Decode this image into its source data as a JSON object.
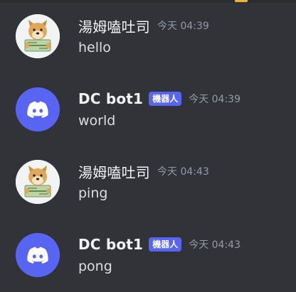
{
  "colors": {
    "background": "#313338",
    "blurple": "#5865f2",
    "username": "#f2f3f5",
    "timestamp": "#949ba4",
    "message_text": "#dbdee1"
  },
  "messages": [
    {
      "author": "湯姆嗑吐司",
      "is_bot": false,
      "avatar_icon": "doge-avatar-icon",
      "timestamp": "今天 04:39",
      "text": "hello"
    },
    {
      "author": "DC bot1",
      "is_bot": true,
      "bot_tag": "機器人",
      "avatar_icon": "discord-logo-icon",
      "timestamp": "今天 04:39",
      "text": "world"
    },
    {
      "author": "湯姆嗑吐司",
      "is_bot": false,
      "avatar_icon": "doge-avatar-icon",
      "timestamp": "今天 04:43",
      "text": "ping"
    },
    {
      "author": "DC bot1",
      "is_bot": true,
      "bot_tag": "機器人",
      "avatar_icon": "discord-logo-icon",
      "timestamp": "今天 04:43",
      "text": "pong"
    }
  ]
}
